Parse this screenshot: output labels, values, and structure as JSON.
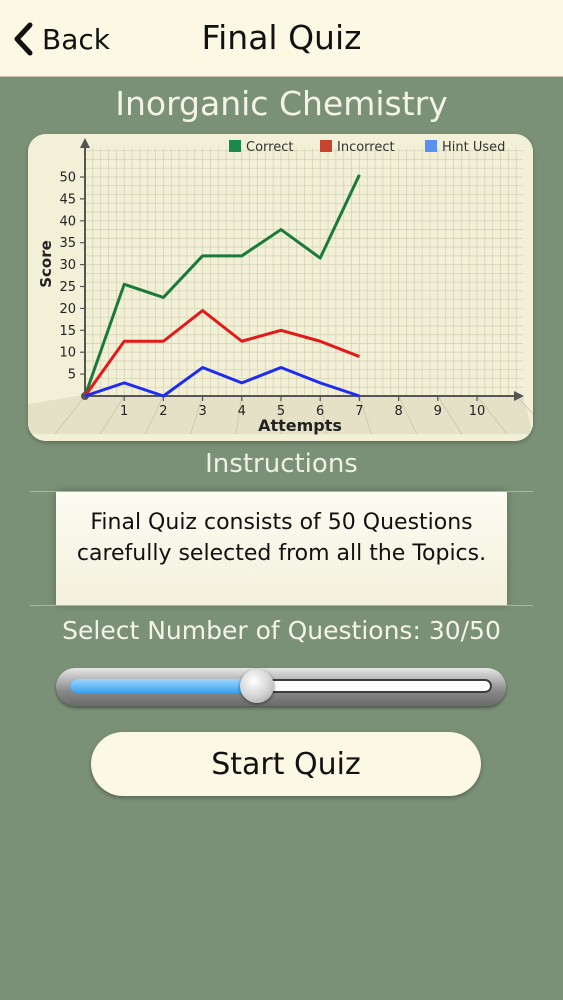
{
  "navbar": {
    "back_label": "Back",
    "title": "Final Quiz"
  },
  "subject": "Inorganic Chemistry",
  "chart_data": {
    "type": "line",
    "xlabel": "Attempts",
    "ylabel": "Score",
    "xlim": [
      0,
      10.5
    ],
    "ylim": [
      0,
      52
    ],
    "x_ticks": [
      1,
      2,
      3,
      4,
      5,
      6,
      7,
      8,
      9,
      10
    ],
    "y_ticks": [
      5,
      10,
      15,
      20,
      25,
      30,
      35,
      40,
      45,
      50
    ],
    "grid": true,
    "legend": "top-right",
    "series": [
      {
        "name": "Correct",
        "color": "#1a7a3c",
        "x": [
          0,
          1,
          2,
          3,
          4,
          5,
          6,
          7
        ],
        "y": [
          0,
          25.5,
          22.5,
          32,
          32,
          38,
          31.5,
          50.5
        ]
      },
      {
        "name": "Incorrect",
        "color": "#e21a1a",
        "x": [
          0,
          1,
          2,
          3,
          4,
          5,
          6,
          7
        ],
        "y": [
          0,
          12.5,
          12.5,
          19.5,
          12.5,
          15,
          12.5,
          9
        ]
      },
      {
        "name": "Hint Used",
        "color": "#1d2cf0",
        "x": [
          0,
          1,
          2,
          3,
          4,
          5,
          6,
          7
        ],
        "y": [
          0,
          3,
          0,
          6.5,
          3,
          6.5,
          3,
          0
        ]
      }
    ],
    "legend_colors": {
      "Correct": "#1a8a4a",
      "Incorrect": "#c8442e",
      "Hint Used": "#5b8ff2"
    }
  },
  "instructions": {
    "label": "Instructions",
    "text": "Final Quiz consists of 50 Questions carefully selected from all the Topics."
  },
  "slider": {
    "label": "Select Number of Questions: 30/50",
    "value": 30,
    "max": 50,
    "fill_color": "#3aa1f0"
  },
  "start_button_label": "Start Quiz"
}
